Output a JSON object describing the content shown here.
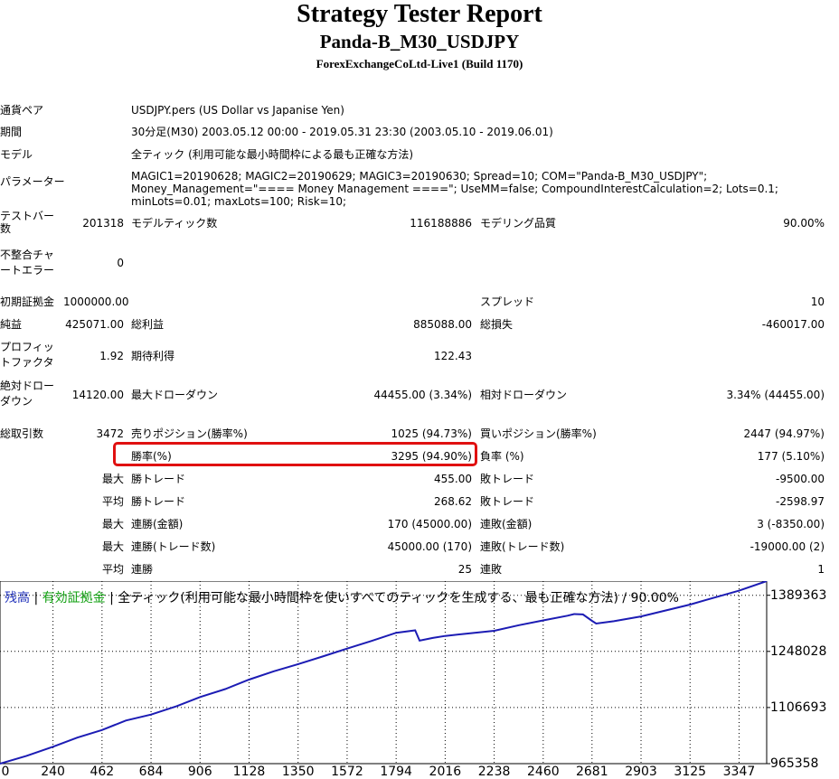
{
  "header": {
    "title": "Strategy Tester Report",
    "subtitle": "Panda-B_M30_USDJPY",
    "server": "ForexExchangeCoLtd-Live1 (Build 1170)"
  },
  "info": {
    "pair_label": "通貨ペア",
    "pair_value": "USDJPY.pers (US Dollar vs Japanise Yen)",
    "period_label": "期間",
    "period_value": "30分足(M30) 2003.05.12 00:00 - 2019.05.31 23:30 (2003.05.10 - 2019.06.01)",
    "model_label": "モデル",
    "model_value": "全ティック (利用可能な最小時間枠による最も正確な方法)",
    "params_label": "パラメーター",
    "params_value": "MAGIC1=20190628; MAGIC2=20190629; MAGIC3=20190630; Spread=10; COM=\"Panda-B_M30_USDJPY\"; Money_Management=\"==== Money Management ====\"; UseMM=false; CompoundInterestCalculation=2; Lots=0.1; minLots=0.01; maxLots=100; Risk=10;"
  },
  "stats": {
    "test_bars_label": "テストバー数",
    "test_bars": "201318",
    "model_ticks_label": "モデルティック数",
    "model_ticks": "116188886",
    "model_quality_label": "モデリング品質",
    "model_quality": "90.00%",
    "mismatch_label": "不整合チャートエラー",
    "mismatch": "0",
    "deposit_label": "初期証拠金",
    "deposit": "1000000.00",
    "spread_label": "スプレッド",
    "spread": "10",
    "net_label": "純益",
    "net": "425071.00",
    "gross_profit_label": "総利益",
    "gross_profit": "885088.00",
    "gross_loss_label": "総損失",
    "gross_loss": "-460017.00",
    "pf_label": "プロフィットファクタ",
    "pf": "1.92",
    "expected_label": "期待利得",
    "expected": "122.43",
    "abs_dd_label": "絶対ドローダウン",
    "abs_dd": "14120.00",
    "max_dd_label": "最大ドローダウン",
    "max_dd": "44455.00 (3.34%)",
    "rel_dd_label": "相対ドローダウン",
    "rel_dd": "3.34% (44455.00)",
    "total_trades_label": "総取引数",
    "total_trades": "3472",
    "short_label": "売りポジション(勝率%)",
    "short": "1025 (94.73%)",
    "long_label": "買いポジション(勝率%)",
    "long": "2447 (94.97%)",
    "win_pct_label": "勝率(%)",
    "win_pct": "3295 (94.90%)",
    "loss_pct_label": "負率 (%)",
    "loss_pct": "177 (5.10%)",
    "max_label": "最大",
    "avg_label": "平均",
    "win_trade_label": "勝トレード",
    "lose_trade_label": "敗トレード",
    "max_win": "455.00",
    "max_loss": "-9500.00",
    "avg_win": "268.62",
    "avg_loss": "-2598.97",
    "consec_win_amt_label": "連勝(金額)",
    "consec_win_amt": "170 (45000.00)",
    "consec_loss_amt_label": "連敗(金額)",
    "consec_loss_amt": "3 (-8350.00)",
    "consec_win_cnt_label": "連勝(トレード数)",
    "consec_win_cnt": "45000.00 (170)",
    "consec_loss_cnt_label": "連敗(トレード数)",
    "consec_loss_cnt": "-19000.00 (2)",
    "avg_consec_win_label": "連勝",
    "avg_consec_win": "25",
    "avg_consec_loss_label": "連敗",
    "avg_consec_loss": "1"
  },
  "legend": {
    "balance": "残高",
    "sep1": " | ",
    "equity": "有効証拠金",
    "rest": " | 全ティック(利用可能な最小時間枠を使いすべてのティックを生成する、最も正確な方法) / 90.00%"
  },
  "colors": {
    "line": "#1c1cb4",
    "balance": "#2233bb",
    "equity": "#10a010",
    "highlight": "#e01010"
  },
  "chart_data": {
    "type": "line",
    "title": "",
    "xlabel": "",
    "ylabel": "",
    "x_ticks": [
      "0",
      "240",
      "462",
      "684",
      "906",
      "1128",
      "1350",
      "1572",
      "1794",
      "2016",
      "2238",
      "2460",
      "2681",
      "2903",
      "3125",
      "3347"
    ],
    "y_ticks": [
      "1389363",
      "1248028",
      "1106693",
      "965358"
    ],
    "xlim": [
      0,
      3472
    ],
    "ylim": [
      965358,
      1425071
    ],
    "series": [
      {
        "name": "残高",
        "x": [
          0,
          120,
          240,
          350,
          462,
          570,
          684,
          800,
          906,
          1020,
          1128,
          1240,
          1350,
          1460,
          1572,
          1680,
          1794,
          1880,
          1900,
          1960,
          2016,
          2100,
          2238,
          2350,
          2460,
          2570,
          2600,
          2640,
          2681,
          2700,
          2780,
          2903,
          3000,
          3125,
          3200,
          3347,
          3472
        ],
        "y": [
          965358,
          985000,
          1008000,
          1031000,
          1050000,
          1074000,
          1089000,
          1110000,
          1133000,
          1153000,
          1177000,
          1198000,
          1216000,
          1235000,
          1255000,
          1274000,
          1295000,
          1301000,
          1275000,
          1282000,
          1287000,
          1292000,
          1300000,
          1314000,
          1326000,
          1338000,
          1342000,
          1341000,
          1325000,
          1318000,
          1324000,
          1336000,
          1349000,
          1366000,
          1378000,
          1401000,
          1425071
        ]
      }
    ]
  }
}
